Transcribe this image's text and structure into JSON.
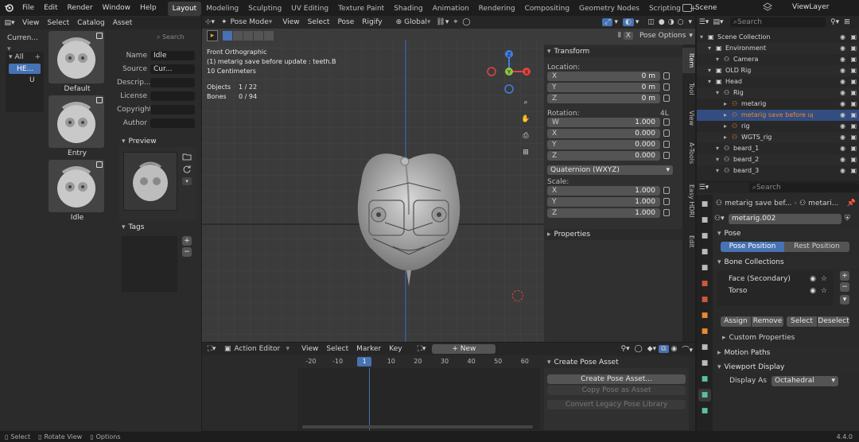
{
  "menu": [
    "File",
    "Edit",
    "Render",
    "Window",
    "Help"
  ],
  "workspaces": [
    "Layout",
    "Modeling",
    "Sculpting",
    "UV Editing",
    "Texture Paint",
    "Shading",
    "Animation",
    "Rendering",
    "Compositing",
    "Geometry Nodes",
    "Scripting"
  ],
  "active_workspace": "Layout",
  "scene": "Scene",
  "view_layer": "ViewLayer",
  "asset_browser": {
    "menus": [
      "View",
      "Select",
      "Catalog",
      "Asset"
    ],
    "current": "Curren...",
    "catalog_all": "All",
    "catalog_items": [
      "HE...",
      "U"
    ],
    "search_placeholder": "Search",
    "assets": [
      "Default",
      "Entry",
      "Idle"
    ],
    "props": [
      {
        "label": "Name",
        "value": "Idle"
      },
      {
        "label": "Source",
        "value": "Cur..."
      },
      {
        "label": "Descrip...",
        "value": ""
      },
      {
        "label": "License",
        "value": ""
      },
      {
        "label": "Copyright",
        "value": ""
      },
      {
        "label": "Author",
        "value": ""
      }
    ],
    "preview_title": "Preview",
    "tags_title": "Tags"
  },
  "viewport": {
    "mode": "Pose Mode",
    "menus": [
      "View",
      "Select",
      "Pose",
      "Rigify"
    ],
    "transform_orientation": "Global",
    "pose_options": "Pose Options",
    "overlay_lines": [
      "Front Orthographic",
      "(1) metarig save before update : teeth.B",
      "10 Centimeters"
    ],
    "stats": [
      {
        "label": "Objects",
        "value": "1 / 22"
      },
      {
        "label": "Bones",
        "value": "0 / 94"
      }
    ],
    "side_tabs": [
      "Item",
      "Tool",
      "View",
      "A-Tools",
      "Easy HDRI",
      "Edit"
    ],
    "transform": {
      "title": "Transform",
      "location_label": "Location:",
      "location": [
        {
          "axis": "X",
          "value": "0 m"
        },
        {
          "axis": "Y",
          "value": "0 m"
        },
        {
          "axis": "Z",
          "value": "0 m"
        }
      ],
      "rotation_label": "Rotation:",
      "rotation_extra": "4L",
      "rotation": [
        {
          "axis": "W",
          "value": "1.000"
        },
        {
          "axis": "X",
          "value": "0.000"
        },
        {
          "axis": "Y",
          "value": "0.000"
        },
        {
          "axis": "Z",
          "value": "0.000"
        }
      ],
      "rotation_mode": "Quaternion (WXYZ)",
      "scale_label": "Scale:",
      "scale": [
        {
          "axis": "X",
          "value": "1.000"
        },
        {
          "axis": "Y",
          "value": "1.000"
        },
        {
          "axis": "Z",
          "value": "1.000"
        }
      ],
      "properties_title": "Properties"
    }
  },
  "action_editor": {
    "mode": "Action Editor",
    "menus": [
      "View",
      "Select",
      "Marker",
      "Key"
    ],
    "new_label": "New",
    "ticks": [
      "-20",
      "-10",
      "1",
      "10",
      "20",
      "30",
      "40",
      "50",
      "60"
    ],
    "current_frame": "1",
    "pose_asset_title": "Create Pose Asset",
    "pose_asset_buttons": [
      "Create Pose Asset...",
      "Copy Pose as Asset",
      "Convert Legacy Pose Library"
    ]
  },
  "outliner": {
    "search_placeholder": "Search",
    "rows": [
      {
        "label": "Scene Collection",
        "indent": 0
      },
      {
        "label": "Environment",
        "indent": 1
      },
      {
        "label": "Camera",
        "indent": 2
      },
      {
        "label": "OLD Rig",
        "indent": 1
      },
      {
        "label": "Head",
        "indent": 1
      },
      {
        "label": "Rig",
        "indent": 2
      },
      {
        "label": "metarig",
        "indent": 3
      },
      {
        "label": "metarig save before up",
        "indent": 3
      },
      {
        "label": "rig",
        "indent": 3
      },
      {
        "label": "WGTS_rig",
        "indent": 3
      },
      {
        "label": "beard_1",
        "indent": 2
      },
      {
        "label": "beard_2",
        "indent": 2
      },
      {
        "label": "beard_3",
        "indent": 2
      }
    ],
    "selected_row": 7
  },
  "properties": {
    "search_placeholder": "Search",
    "breadcrumb": [
      "metarig save bef...",
      "metari..."
    ],
    "armature": "metarig.002",
    "pose_title": "Pose",
    "pose_position": "Pose Position",
    "rest_position": "Rest Position",
    "bone_collections_title": "Bone Collections",
    "bone_collections": [
      "Face (Secondary)",
      "Torso"
    ],
    "bc_buttons": [
      "Assign",
      "Remove",
      "Select",
      "Deselect"
    ],
    "custom_properties": "Custom Properties",
    "motion_paths": "Motion Paths",
    "viewport_display": "Viewport Display",
    "display_as_label": "Display As",
    "display_as": "Octahedral"
  },
  "statusbar": {
    "items": [
      "Select",
      "Rotate View",
      "Options"
    ],
    "version": "4.4.0"
  },
  "colors": {
    "accent": "#4772b3",
    "x_axis": "#e0453f",
    "y_axis": "#8ec63f",
    "z_axis": "#3f7fe0",
    "selection": "#e88a2e"
  }
}
